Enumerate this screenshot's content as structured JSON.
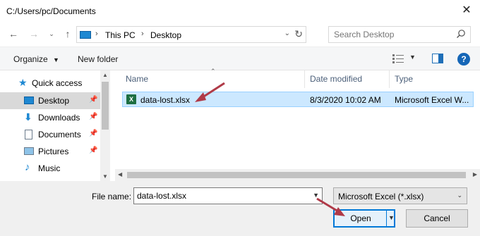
{
  "window": {
    "title": "C:/Users/pc/Documents"
  },
  "address": {
    "crumbs": [
      "This PC",
      "Desktop"
    ]
  },
  "search": {
    "placeholder": "Search Desktop"
  },
  "toolbar": {
    "organize": "Organize",
    "new_folder": "New folder",
    "help": "?"
  },
  "sidebar": {
    "items": [
      {
        "label": "Quick access",
        "icon": "star-icon"
      },
      {
        "label": "Desktop",
        "icon": "desktop-folder-icon",
        "selected": true,
        "pinned": true
      },
      {
        "label": "Downloads",
        "icon": "download-arrow-icon",
        "pinned": true
      },
      {
        "label": "Documents",
        "icon": "document-icon",
        "pinned": true
      },
      {
        "label": "Pictures",
        "icon": "picture-icon",
        "pinned": true
      },
      {
        "label": "Music",
        "icon": "music-note-icon"
      }
    ]
  },
  "files": {
    "columns": [
      "Name",
      "Date modified",
      "Type"
    ],
    "rows": [
      {
        "name": "data-lost.xlsx",
        "date": "8/3/2020 10:02 AM",
        "type": "Microsoft Excel W...",
        "icon": "excel-file-icon",
        "selected": true
      }
    ]
  },
  "footer": {
    "file_name_label": "File name:",
    "file_name_value": "data-lost.xlsx",
    "file_type": "Microsoft Excel (*.xlsx)",
    "open_label": "Open",
    "cancel_label": "Cancel"
  },
  "colors": {
    "accent": "#0078d7",
    "selection": "#cce8ff",
    "annotation_arrow": "#b03a48"
  }
}
